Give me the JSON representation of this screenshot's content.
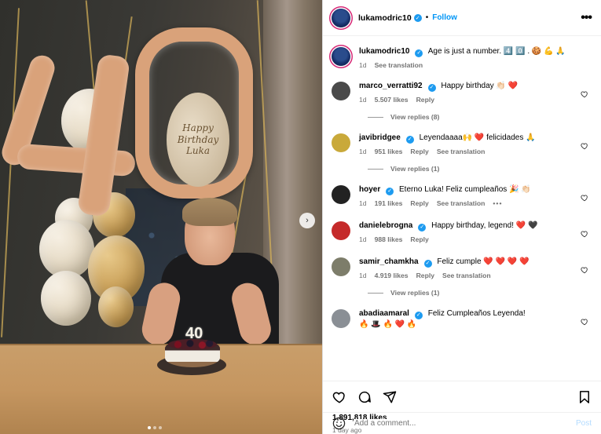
{
  "header": {
    "username": "lukamodric10",
    "dot": "•",
    "follow_label": "Follow",
    "more_label": "•••"
  },
  "caption": {
    "username": "lukamodric10",
    "text": "Age is just a number. 4️⃣ 0️⃣ . 🍪 💪 🙏",
    "time": "1d",
    "translation_label": "See translation"
  },
  "photo": {
    "balloon_zero_text": "Happy Birthday Luka",
    "candle_text": "40",
    "carousel_next_icon": "chevron-right-icon"
  },
  "comments": [
    {
      "username": "marco_verratti92",
      "text": "Happy birthday 👏🏻 ❤️",
      "time": "1d",
      "likes": "5.507 likes",
      "reply": "Reply",
      "translation": "",
      "replies": "View replies (8)",
      "avatar_color": "#4a4a4a"
    },
    {
      "username": "javibridgee",
      "text": "Leyendaaaa🙌 ❤️  felicidades 🙏",
      "time": "1d",
      "likes": "951 likes",
      "reply": "Reply",
      "translation": "See translation",
      "replies": "View replies (1)",
      "avatar_color": "#c9a93a"
    },
    {
      "username": "hoyer",
      "text": "Eterno Luka! Feliz cumpleaños 🎉 👏🏻",
      "time": "1d",
      "likes": "191 likes",
      "reply": "Reply",
      "translation": "See translation",
      "replies": "",
      "avatar_color": "#222222"
    },
    {
      "username": "danielebrogna",
      "text": "Happy birthday, legend! ❤️ 🖤",
      "time": "1d",
      "likes": "988 likes",
      "reply": "Reply",
      "translation": "",
      "replies": "",
      "avatar_color": "#c52a2a"
    },
    {
      "username": "samir_chamkha",
      "text": "Feliz cumple ❤️ ❤️ ❤️ ❤️",
      "time": "1d",
      "likes": "4.919 likes",
      "reply": "Reply",
      "translation": "See translation",
      "replies": "View replies (1)",
      "avatar_color": "#7d7d6a"
    },
    {
      "username": "abadiaamaral",
      "text": "Feliz Cumpleaños Leyenda!",
      "line2": "🔥 🎩 🔥 ❤️ 🔥",
      "time": "",
      "likes": "",
      "reply": "",
      "translation": "",
      "replies": "",
      "avatar_color": "#8a8f95"
    }
  ],
  "hoyer_more": "•••",
  "likes": "1,891,818 likes",
  "ago": "1 day ago",
  "add_comment": {
    "placeholder": "Add a comment...",
    "post_label": "Post"
  },
  "colors": {
    "accent": "#0095f6",
    "verified": "#1d9bf0",
    "heart": "#ed4956",
    "muted": "#737373"
  }
}
